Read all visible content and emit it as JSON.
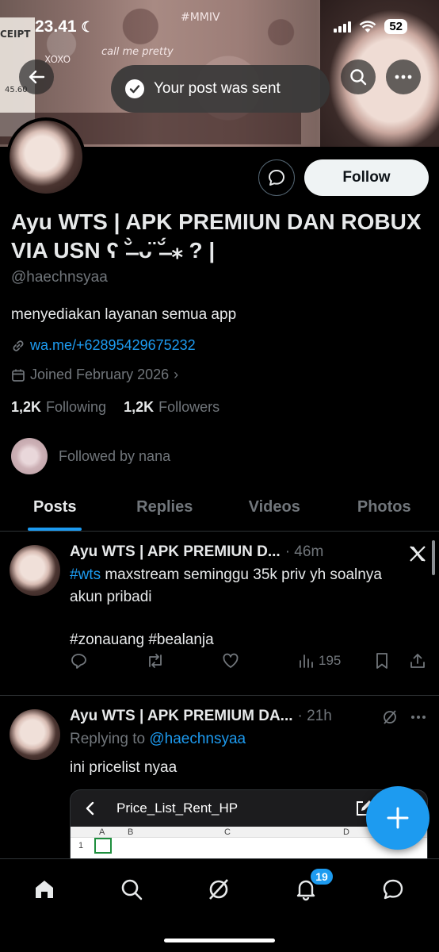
{
  "status_bar": {
    "time": "23.41",
    "battery": "52"
  },
  "banner": {
    "deco_1": "call me pretty",
    "deco_2": "XOXO",
    "deco_3": "#MMIV",
    "deco_4": "CEIPT",
    "deco_5": "45.60"
  },
  "toast": {
    "text": "Your post was sent"
  },
  "profile": {
    "follow_label": "Follow",
    "name": "Ayu WTS | APK PREMIUN DAN ROBUX VIA USN ʕ ˘̶̀ ᴗ̈ ˘̶́ ⁎ ? |",
    "handle": "@haechnsyaa",
    "bio": "menyediakan layanan semua app",
    "link": "wa.me/+62895429675232",
    "joined": "Joined February 2026",
    "following_count": "1,2K",
    "following_label": "Following",
    "followers_count": "1,2K",
    "followers_label": "Followers",
    "followed_by": "Followed by nana"
  },
  "tabs": [
    {
      "label": "Posts",
      "active": true
    },
    {
      "label": "Replies",
      "active": false
    },
    {
      "label": "Videos",
      "active": false
    },
    {
      "label": "Photos",
      "active": false
    }
  ],
  "tweets": [
    {
      "name": "Ayu WTS | APK PREMIUN D...",
      "time": "· 46m",
      "tag1": "#wts",
      "text1": " maxstream seminggu 35k priv yh soalnya akun pribadi",
      "tags2": "#zonauang #bealanja",
      "views": "195"
    },
    {
      "name": "Ayu WTS | APK PREMIUM DA...",
      "time": "· 21h",
      "replying_prefix": "Replying to ",
      "replying_to": "@haechnsyaa",
      "text": "ini pricelist nyaa",
      "sheet_title": "Price_List_Rent_HP",
      "sheet_cols": [
        "A",
        "B",
        "C",
        "D"
      ],
      "sheet_row": "1"
    }
  ],
  "notifications_badge": "19",
  "colors": {
    "accent": "#1d9bf0",
    "bg": "#000000",
    "muted": "#71767b"
  }
}
